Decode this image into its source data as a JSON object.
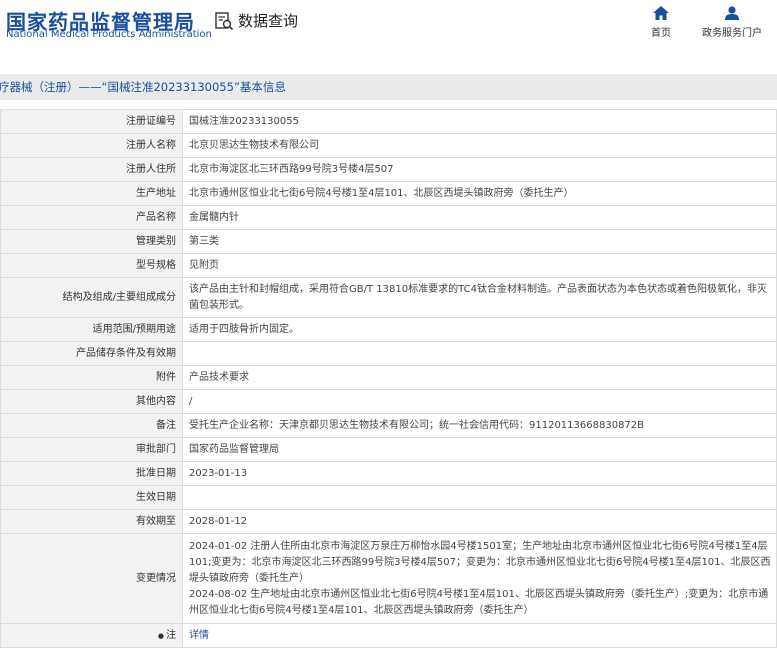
{
  "header": {
    "logo_cn": "国家药品监督管理局",
    "logo_en": "National Medical Products Administration",
    "query_label": "数据查询",
    "nav_home": "首页",
    "nav_service": "政务服务门户"
  },
  "breadcrumb": "疗器械（注册）——“国械注准20233130055”基本信息",
  "rows": [
    {
      "label": "注册证编号",
      "value": "国械注准20233130055"
    },
    {
      "label": "注册人名称",
      "value": "北京贝思达生物技术有限公司"
    },
    {
      "label": "注册人住所",
      "value": "北京市海淀区北三环西路99号院3号楼4层507"
    },
    {
      "label": "生产地址",
      "value": "北京市通州区恒业北七街6号院4号楼1至4层101、北辰区西堤头镇政府旁（委托生产）"
    },
    {
      "label": "产品名称",
      "value": "金属髓内针"
    },
    {
      "label": "管理类别",
      "value": "第三类"
    },
    {
      "label": "型号规格",
      "value": "见附页"
    },
    {
      "label": "结构及组成/主要组成成分",
      "value": "该产品由主针和封帽组成，采用符合GB/T 13810标准要求的TC4钛合金材料制造。产品表面状态为本色状态或着色阳极氧化，非灭菌包装形式。"
    },
    {
      "label": "适用范围/预期用途",
      "value": "适用于四肢骨折内固定。"
    },
    {
      "label": "产品储存条件及有效期",
      "value": ""
    },
    {
      "label": "附件",
      "value": "产品技术要求"
    },
    {
      "label": "其他内容",
      "value": "/"
    },
    {
      "label": "备注",
      "value": "受托生产企业名称：天津京都贝思达生物技术有限公司；统一社会信用代码：91120113668830872B"
    },
    {
      "label": "审批部门",
      "value": "国家药品监督管理局"
    },
    {
      "label": "批准日期",
      "value": "2023-01-13"
    },
    {
      "label": "生效日期",
      "value": ""
    },
    {
      "label": "有效期至",
      "value": "2028-01-12"
    },
    {
      "label": "变更情况",
      "value": "2024-01-02 注册人住所由北京市海淀区万泉庄万柳怡水园4号楼1501室；生产地址由北京市通州区恒业北七街6号院4号楼1至4层101;变更为：北京市海淀区北三环西路99号院3号楼4层507；变更为：北京市通州区恒业北七街6号院4号楼1至4层101、北辰区西堤头镇政府旁（委托生产）\n2024-08-02 生产地址由北京市通州区恒业北七街6号院4号楼1至4层101、北辰区西堤头镇政府旁（委托生产）;变更为：北京市通州区恒业北七街6号院4号楼1至4层101、北辰区西堤头镇政府旁（委托生产）"
    },
    {
      "label": "注",
      "value": "详情"
    }
  ],
  "note_marker": "●"
}
